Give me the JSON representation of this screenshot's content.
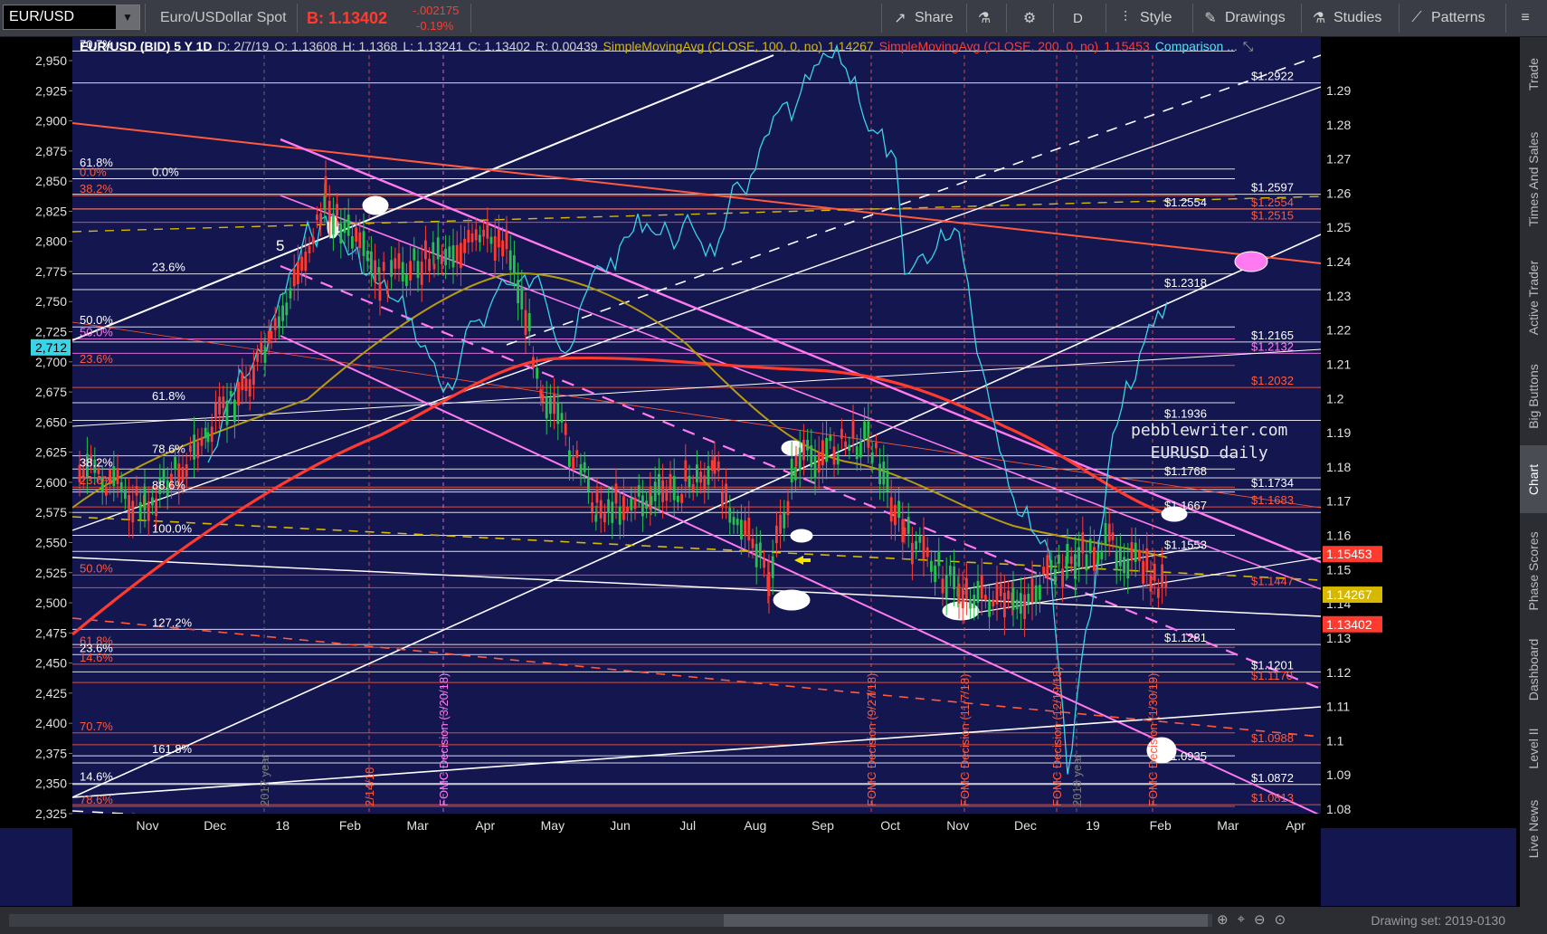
{
  "toolbar": {
    "symbol": "EUR/USD",
    "description": "Euro/USDollar Spot",
    "bid": "B: 1.13402",
    "change": "-.002175",
    "change_pct": "-0.19%",
    "share": "Share",
    "period": "D",
    "style": "Style",
    "drawings": "Drawings",
    "studies": "Studies",
    "patterns": "Patterns",
    "accent": "#ff3b30"
  },
  "legend": {
    "title": "EUR/USD (BID) 5 Y 1D",
    "date": "D: 2/7/19",
    "open": "O: 1.13608",
    "high": "H: 1.1368",
    "low": "L: 1.13241",
    "close": "C: 1.13402",
    "range": "R: 0.00439",
    "sma100": "SimpleMovingAvg (CLOSE, 100, 0, no)",
    "sma100_val": "1.14267",
    "sma200": "SimpleMovingAvg (CLOSE, 200, 0, no)",
    "sma200_val": "1.15453",
    "comparison": "Comparison ..."
  },
  "watermark": [
    "pebblewriter.com",
    "EURUSD daily"
  ],
  "chart_data": {
    "type": "line",
    "title": "EUR/USD (BID) 5 Y 1D",
    "x_ticks": [
      "Nov",
      "Dec",
      "18",
      "Feb",
      "Mar",
      "Apr",
      "May",
      "Jun",
      "Jul",
      "Aug",
      "Sep",
      "Oct",
      "Nov",
      "Dec",
      "19",
      "Feb",
      "Mar",
      "Apr"
    ],
    "left_axis_ticks": [
      "2,950",
      "2,925",
      "2,900",
      "2,875",
      "2,850",
      "2,825",
      "2,800",
      "2,775",
      "2,750",
      "2,725",
      "2,700",
      "2,675",
      "2,650",
      "2,625",
      "2,600",
      "2,575",
      "2,550",
      "2,525",
      "2,500",
      "2,475",
      "2,450",
      "2,425",
      "2,400",
      "2,375",
      "2,350",
      "2,325"
    ],
    "left_axis_range": [
      2325,
      2950
    ],
    "left_marker": "2,712",
    "right_axis_ticks": [
      "1.29",
      "1.28",
      "1.27",
      "1.26",
      "1.25",
      "1.24",
      "1.23",
      "1.22",
      "1.21",
      "1.2",
      "1.19",
      "1.18",
      "1.17",
      "1.16",
      "1.15",
      "1.14",
      "1.13",
      "1.12",
      "1.11",
      "1.1",
      "1.09",
      "1.08"
    ],
    "right_axis_range": [
      1.08,
      1.29
    ],
    "right_markers": [
      {
        "label": "1.15453",
        "color": "#ff3b30"
      },
      {
        "label": "1.14267",
        "color": "#d6b800"
      },
      {
        "label": "1.13402",
        "color": "#ff3b30"
      }
    ],
    "fib_labels_left": [
      {
        "text": "70.7%",
        "v": 2958,
        "c": "#ffffff"
      },
      {
        "text": "61.8%",
        "v": 2860,
        "c": "#ffffff"
      },
      {
        "text": "0.0%",
        "v": 2852,
        "c": "#ff5a3c"
      },
      {
        "text": "0.0%",
        "v": 2852,
        "c": "#ffffff",
        "x2": true
      },
      {
        "text": "38.2%",
        "v": 2838,
        "c": "#ff5a3c"
      },
      {
        "text": "23.6%",
        "v": 2773,
        "c": "#ffffff",
        "x2": true
      },
      {
        "text": "50.0%",
        "v": 2729,
        "c": "#ffffff"
      },
      {
        "text": "50.0%",
        "v": 2719,
        "c": "#ff7af0"
      },
      {
        "text": "23.6%",
        "v": 2697,
        "c": "#ff5a3c"
      },
      {
        "text": "61.8%",
        "v": 2666,
        "c": "#ffffff",
        "x2": true
      },
      {
        "text": "78.6%",
        "v": 2622,
        "c": "#ffffff",
        "x2": true
      },
      {
        "text": "38.2%",
        "v": 2611,
        "c": "#ffffff"
      },
      {
        "text": "23.6%",
        "v": 2596,
        "c": "#ff5a3c"
      },
      {
        "text": "88.6%",
        "v": 2592,
        "c": "#ffffff",
        "x2": true
      },
      {
        "text": "100.0%",
        "v": 2556,
        "c": "#ffffff",
        "x2": true
      },
      {
        "text": "50.0%",
        "v": 2523,
        "c": "#ff5a3c"
      },
      {
        "text": "127.2%",
        "v": 2478,
        "c": "#ffffff",
        "x2": true
      },
      {
        "text": "61.8%",
        "v": 2463,
        "c": "#ff5a3c"
      },
      {
        "text": "23.6%",
        "v": 2457,
        "c": "#ffffff"
      },
      {
        "text": "14.6%",
        "v": 2449,
        "c": "#ff5a3c"
      },
      {
        "text": "70.7%",
        "v": 2392,
        "c": "#ff5a3c"
      },
      {
        "text": "161.8%",
        "v": 2373,
        "c": "#ffffff",
        "x2": true
      },
      {
        "text": "14.6%",
        "v": 2350,
        "c": "#ffffff"
      },
      {
        "text": "78.6%",
        "v": 2331,
        "c": "#ff5a3c"
      }
    ],
    "fib_labels_right": [
      {
        "text": "$1.2922",
        "v": 1.2922,
        "c": "#ffffff"
      },
      {
        "text": "$1.2597",
        "v": 1.2597,
        "c": "#ffffff"
      },
      {
        "text": "$1.2554",
        "v": 1.2554,
        "c": "#ffffff",
        "mid": true
      },
      {
        "text": "$1.2554",
        "v": 1.2554,
        "c": "#ff5a3c"
      },
      {
        "text": "$1.2515",
        "v": 1.2515,
        "c": "#ff5a3c"
      },
      {
        "text": "$1.2318",
        "v": 1.2318,
        "c": "#ffffff",
        "mid": true
      },
      {
        "text": "$1.2165",
        "v": 1.2165,
        "c": "#ffffff"
      },
      {
        "text": "$1.2132",
        "v": 1.2132,
        "c": "#ff7af0"
      },
      {
        "text": "$1.2032",
        "v": 1.2032,
        "c": "#ff5a3c"
      },
      {
        "text": "$1.1936",
        "v": 1.1936,
        "c": "#ffffff",
        "mid": true
      },
      {
        "text": "$1.1768",
        "v": 1.1768,
        "c": "#ffffff",
        "mid": true
      },
      {
        "text": "$1.1734",
        "v": 1.1734,
        "c": "#ffffff"
      },
      {
        "text": "$1.1667",
        "v": 1.1667,
        "c": "#ffffff",
        "mid": true
      },
      {
        "text": "$1.1683",
        "v": 1.1683,
        "c": "#ff5a3c"
      },
      {
        "text": "$1.1553",
        "v": 1.1553,
        "c": "#ffffff",
        "mid": true
      },
      {
        "text": "$1.1447",
        "v": 1.1447,
        "c": "#ff5a3c"
      },
      {
        "text": "$1.1281",
        "v": 1.1281,
        "c": "#ffffff",
        "mid": true
      },
      {
        "text": "$1.1201",
        "v": 1.1201,
        "c": "#ffffff"
      },
      {
        "text": "$1.1170",
        "v": 1.117,
        "c": "#ff5a3c"
      },
      {
        "text": "$1.0988",
        "v": 1.0988,
        "c": "#ff5a3c"
      },
      {
        "text": "$1.0935",
        "v": 1.0935,
        "c": "#ffffff",
        "mid": true
      },
      {
        "text": "$1.0872",
        "v": 1.0872,
        "c": "#ffffff"
      },
      {
        "text": "$1.0813",
        "v": 1.0813,
        "c": "#ff5a3c"
      }
    ],
    "vertical_labels": [
      {
        "text": "2017 year",
        "c": "#7a7a7a"
      },
      {
        "text": "2/14/18",
        "c": "#ff5a3c"
      },
      {
        "text": "FOMC Decision (3/20/18)",
        "c": "#ff7af0"
      },
      {
        "text": "FOMC Decision (9/27/18)",
        "c": "#ff5a3c"
      },
      {
        "text": "FOMC Decision (11/7/18)",
        "c": "#ff5a3c"
      },
      {
        "text": "FOMC Decision (12/19/18)",
        "c": "#ff5a3c"
      },
      {
        "text": "2018 year",
        "c": "#7a7a7a"
      },
      {
        "text": "FOMC Decision (1/30/19)",
        "c": "#ff5a3c"
      }
    ],
    "wave_label": "5",
    "grid": false
  },
  "right_tabs": [
    "Trade",
    "Times And Sales",
    "Active Trader",
    "Big Buttons",
    "Chart",
    "Phase Scores",
    "Dashboard",
    "Level II",
    "Live News"
  ],
  "active_tab": "Chart",
  "status": {
    "drawing_set": "Drawing set: 2019-0130"
  }
}
